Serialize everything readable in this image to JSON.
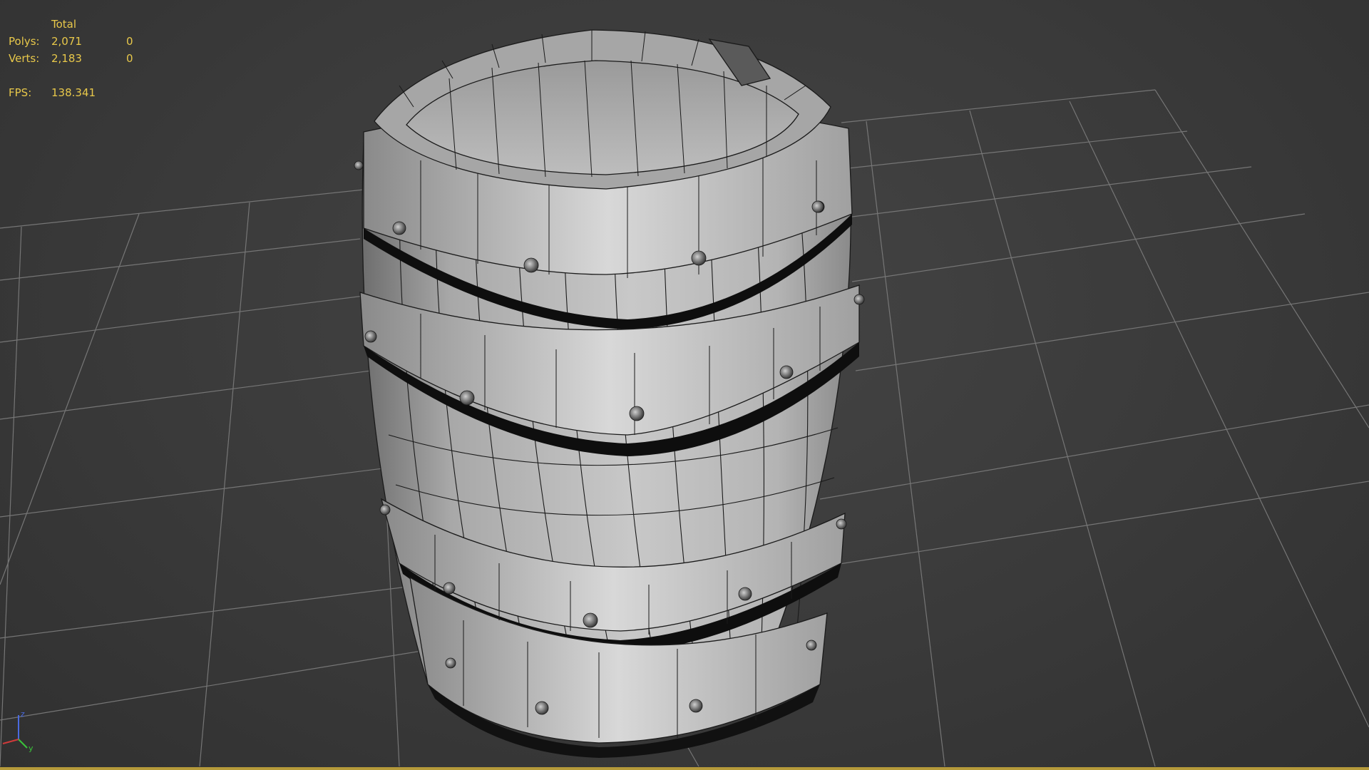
{
  "stats": {
    "header": "Total",
    "polys_label": "Polys:",
    "polys_total": "2,071",
    "polys_selected": "0",
    "verts_label": "Verts:",
    "verts_total": "2,183",
    "verts_selected": "0",
    "fps_label": "FPS:",
    "fps_value": "138.341"
  },
  "gizmo": {
    "z_label": "z",
    "y_label": "y",
    "x_color": "#d03a3a",
    "y_color": "#3ac23a",
    "z_color": "#4a6ae0"
  },
  "colors": {
    "stats_text": "#e8c84a",
    "grid": "#7a7a7a",
    "viewport_bg": "#3a3a3a",
    "status_accent": "#b59a3a"
  },
  "viewport": {
    "object": "barrel-mesh"
  }
}
